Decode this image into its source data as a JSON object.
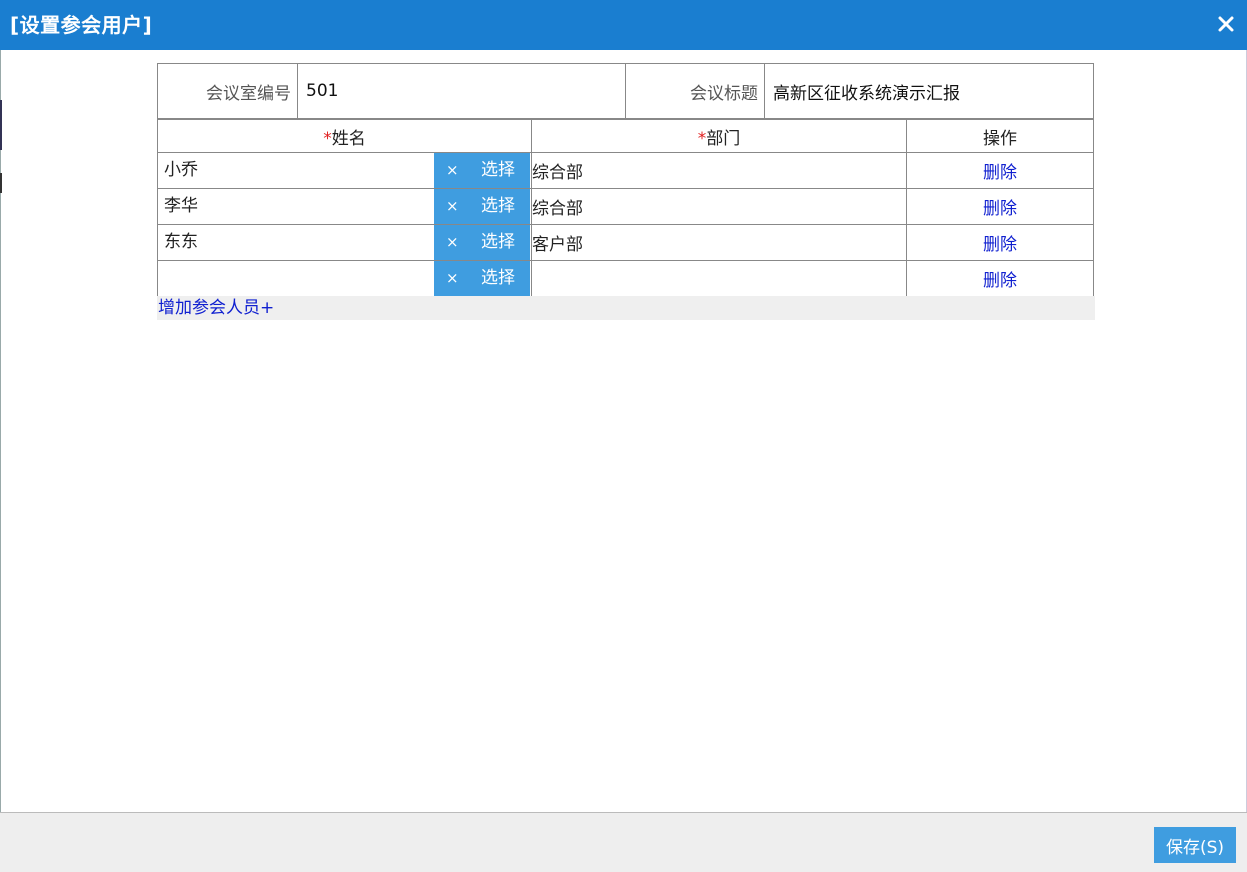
{
  "dialog": {
    "title": "[设置参会用户]"
  },
  "info": {
    "room_label": "会议室编号",
    "room_value": "501",
    "title_label": "会议标题",
    "title_value": "高新区征收系统演示汇报"
  },
  "table": {
    "required_mark": "*",
    "col_name": "姓名",
    "col_dept": "部门",
    "col_op": "操作",
    "clear_symbol": "×",
    "select_label": "选择",
    "delete_label": "删除",
    "rows": [
      {
        "name": "小乔",
        "dept": "综合部"
      },
      {
        "name": "李华",
        "dept": "综合部"
      },
      {
        "name": "东东",
        "dept": "客户部"
      },
      {
        "name": "",
        "dept": ""
      }
    ]
  },
  "add_member_label": "增加参会人员+",
  "footer": {
    "save_label": "保存(S)"
  },
  "colors": {
    "titlebar": "#1a7ed0",
    "button": "#3f9de0",
    "link": "#1020d0",
    "required": "#e02020"
  }
}
